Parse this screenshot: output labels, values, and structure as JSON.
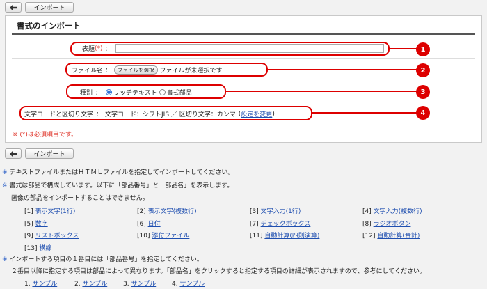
{
  "toolbar": {
    "back_label": "",
    "import_label": "インポート"
  },
  "panel": {
    "title": "書式のインポート",
    "title_field": {
      "label": "表題",
      "required_mark": "(*)",
      "separator": "：",
      "value": ""
    },
    "file_field": {
      "label": "ファイル名",
      "separator": "：",
      "button": "ファイルを選択",
      "status": "ファイルが未選択です"
    },
    "type_field": {
      "label": "種別",
      "separator": "：",
      "options": [
        "リッチテキスト",
        "書式部品"
      ],
      "selected": 0
    },
    "encoding_field": {
      "label": "文字コードと区切り文字",
      "separator": "：",
      "value": "文字コード：シフトJIS ／ 区切り文字：カンマ",
      "paren_open": "(",
      "link": "設定を変更",
      "paren_close": ")"
    },
    "required_note": "※ (*)は必須項目です。"
  },
  "callouts": [
    "1",
    "2",
    "3",
    "4"
  ],
  "notes": {
    "mark": "※",
    "line1": "テキストファイルまたはＨＴＭＬファイルを指定してインポートしてください。",
    "line2": "書式は部品で構成しています。以下に「部品番号」と「部品名」を表示します。",
    "line2b": "画像の部品をインポートすることはできません。",
    "line3": "インポートする項目の１番目には「部品番号」を指定してください。",
    "line3b": "２番目以降に指定する項目は部品によって異なります。「部品名」をクリックすると指定する項目の詳細が表示されますので、参考にしてください。"
  },
  "parts": [
    {
      "num": "[1]",
      "name": "表示文字(1行)"
    },
    {
      "num": "[2]",
      "name": "表示文字(複数行)"
    },
    {
      "num": "[3]",
      "name": "文字入力(1行)"
    },
    {
      "num": "[4]",
      "name": "文字入力(複数行)"
    },
    {
      "num": "[5]",
      "name": "数字"
    },
    {
      "num": "[6]",
      "name": "日付"
    },
    {
      "num": "[7]",
      "name": "チェックボックス"
    },
    {
      "num": "[8]",
      "name": "ラジオボタン"
    },
    {
      "num": "[9]",
      "name": "リストボックス"
    },
    {
      "num": "[10]",
      "name": "添付ファイル"
    },
    {
      "num": "[11]",
      "name": "自動計算(四則演算)"
    },
    {
      "num": "[12]",
      "name": "自動計算(合計)"
    },
    {
      "num": "[13]",
      "name": "横線"
    }
  ],
  "samples": [
    {
      "num": "1.",
      "link": "サンプル"
    },
    {
      "num": "2.",
      "link": "サンプル"
    },
    {
      "num": "3.",
      "link": "サンプル"
    },
    {
      "num": "4.",
      "link": "サンプル"
    }
  ]
}
